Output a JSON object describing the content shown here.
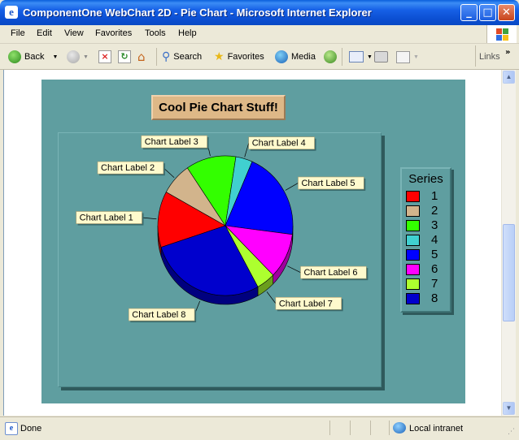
{
  "window": {
    "title": "ComponentOne WebChart 2D - Pie Chart - Microsoft Internet Explorer",
    "app_icon": "ie-page-icon"
  },
  "menu": [
    "File",
    "Edit",
    "View",
    "Favorites",
    "Tools",
    "Help"
  ],
  "toolbar": {
    "back": "Back",
    "search": "Search",
    "favorites": "Favorites",
    "media": "Media",
    "links": "Links"
  },
  "status": {
    "text": "Done",
    "zone": "Local intranet"
  },
  "colors": {
    "chart_background": "#5f9ea0",
    "title_background": "#deb887"
  },
  "chart_data": {
    "type": "pie",
    "title": "Cool Pie Chart Stuff!",
    "legend_title": "Series",
    "legend_position": "right",
    "series": [
      {
        "name": "1",
        "value": 13.0,
        "color": "#ff0000"
      },
      {
        "name": "2",
        "value": 7.5,
        "color": "#d2b48c"
      },
      {
        "name": "3",
        "value": 12.0,
        "color": "#33ff00"
      },
      {
        "name": "4",
        "value": 4.0,
        "color": "#40d0d0"
      },
      {
        "name": "5",
        "value": 20.5,
        "color": "#0000ff"
      },
      {
        "name": "6",
        "value": 10.5,
        "color": "#ff00ff"
      },
      {
        "name": "7",
        "value": 4.5,
        "color": "#adff2f"
      },
      {
        "name": "8",
        "value": 28.0,
        "color": "#0000cd"
      }
    ],
    "labels": [
      "Chart Label 1",
      "Chart Label 2",
      "Chart Label 3",
      "Chart Label 4",
      "Chart Label 5",
      "Chart Label 6",
      "Chart Label 7",
      "Chart Label 8"
    ]
  }
}
